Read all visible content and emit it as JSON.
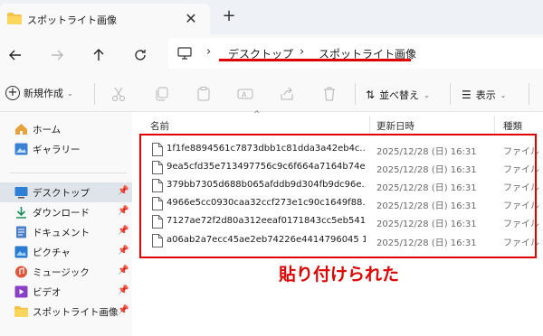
{
  "tab": {
    "title": "スポットライト画像",
    "close": "✕",
    "new": "+"
  },
  "address": {
    "separator": "›",
    "crumbs": [
      "デスクトップ",
      "スポットライト画像"
    ]
  },
  "toolbar": {
    "new_label": "新規作成",
    "sort_label": "並べ替え",
    "view_label": "表示"
  },
  "sidebar": {
    "items": [
      {
        "label": "ホーム",
        "icon": "home-icon"
      },
      {
        "label": "ギャラリー",
        "icon": "gallery-icon"
      },
      {
        "label": "デスクトップ",
        "icon": "desktop-icon",
        "pinned": true,
        "selected": true
      },
      {
        "label": "ダウンロード",
        "icon": "download-icon",
        "pinned": true
      },
      {
        "label": "ドキュメント",
        "icon": "document-icon",
        "pinned": true
      },
      {
        "label": "ピクチャ",
        "icon": "pictures-icon",
        "pinned": true
      },
      {
        "label": "ミュージック",
        "icon": "music-icon",
        "pinned": true
      },
      {
        "label": "ビデオ",
        "icon": "video-icon",
        "pinned": true
      },
      {
        "label": "スポットライト画像",
        "icon": "folder-icon",
        "pinned": true
      }
    ],
    "pin_glyph": "📌"
  },
  "columns": {
    "name": "名前",
    "modified": "更新日時",
    "type": "種類"
  },
  "files": [
    {
      "name": "1f1fe8894561c7873dbb1c81dda3a42eb4c...",
      "modified": "2025/12/28 (日) 16:31",
      "type": "ファイル"
    },
    {
      "name": "9ea5cfd35e713497756c9c6f664a7164b74e...",
      "modified": "2025/12/28 (日) 16:31",
      "type": "ファイル"
    },
    {
      "name": "379bb7305d688b065afddb9d304fb9dc96e...",
      "modified": "2025/12/28 (日) 16:31",
      "type": "ファイル"
    },
    {
      "name": "4966e5cc0930caa32ccf273e1c90c1649f88...",
      "modified": "2025/12/28 (日) 16:31",
      "type": "ファイル"
    },
    {
      "name": "7127ae72f2d80a312eeaf0171843cc5eb541...",
      "modified": "2025/12/28 (日) 16:31",
      "type": "ファイル"
    },
    {
      "name": "a06ab2a7ecc45ae2eb74226e4414796045 1...",
      "modified": "2025/12/28 (日) 16:31",
      "type": "ファイル"
    }
  ],
  "annotation": "貼り付けられた",
  "colors": {
    "accent_red": "#e00000",
    "selected_bg": "#dfe3ea"
  }
}
